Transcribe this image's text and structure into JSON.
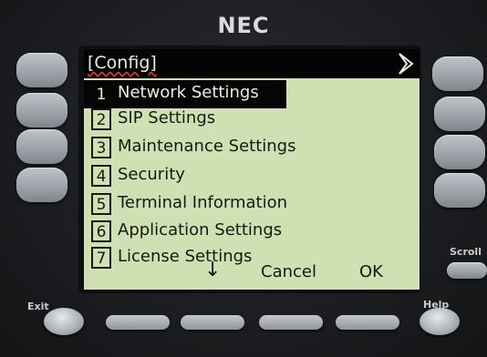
{
  "device": {
    "brand": "NEC"
  },
  "screen": {
    "title": "[Config]",
    "menu": [
      {
        "num": "1",
        "label": "Network Settings",
        "selected": true
      },
      {
        "num": "2",
        "label": "SIP Settings"
      },
      {
        "num": "3",
        "label": "Maintenance Settings"
      },
      {
        "num": "4",
        "label": "Security"
      },
      {
        "num": "5",
        "label": "Terminal Information"
      },
      {
        "num": "6",
        "label": "Application Settings"
      },
      {
        "num": "7",
        "label": "License Settings"
      }
    ],
    "softkeys": {
      "cancel": "Cancel",
      "ok": "OK"
    }
  },
  "hardware": {
    "exit_label": "Exit",
    "help_label": "Help",
    "scroll_label": "Scroll"
  },
  "colors": {
    "lcd_background": "#cfe1b3",
    "selection": "#050505",
    "body": "#1c1e21"
  }
}
